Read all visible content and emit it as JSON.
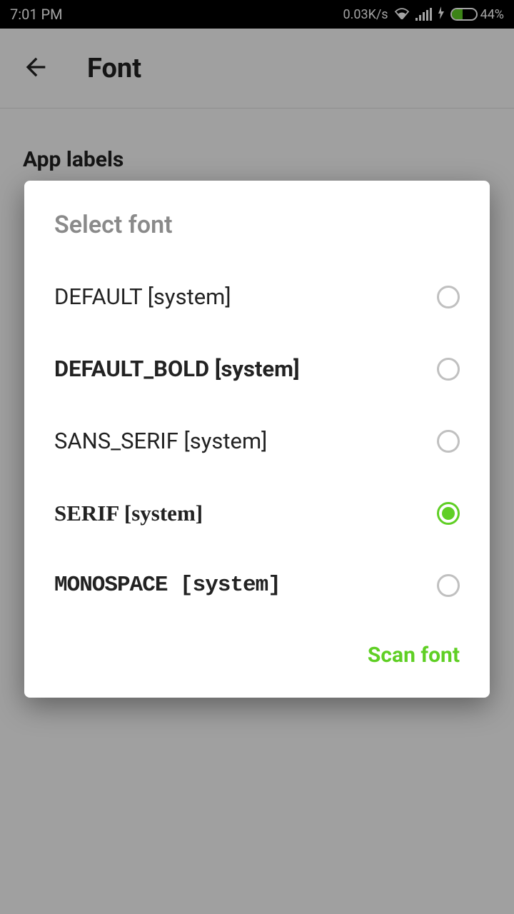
{
  "status": {
    "time": "7:01 PM",
    "data_rate": "0.03K/s",
    "battery_percent": "44%"
  },
  "header": {
    "title": "Font"
  },
  "section": {
    "title": "App labels"
  },
  "dialog": {
    "title": "Select font",
    "action": "Scan font",
    "options": [
      {
        "label": "DEFAULT [system]",
        "style": "",
        "selected": false
      },
      {
        "label": "DEFAULT_BOLD [system]",
        "style": "bold",
        "selected": false
      },
      {
        "label": "SANS_SERIF [system]",
        "style": "",
        "selected": false
      },
      {
        "label": "SERIF [system]",
        "style": "serif",
        "selected": true
      },
      {
        "label": "MONOSPACE [system]",
        "style": "mono",
        "selected": false
      }
    ]
  },
  "colors": {
    "accent": "#5fcf24"
  }
}
